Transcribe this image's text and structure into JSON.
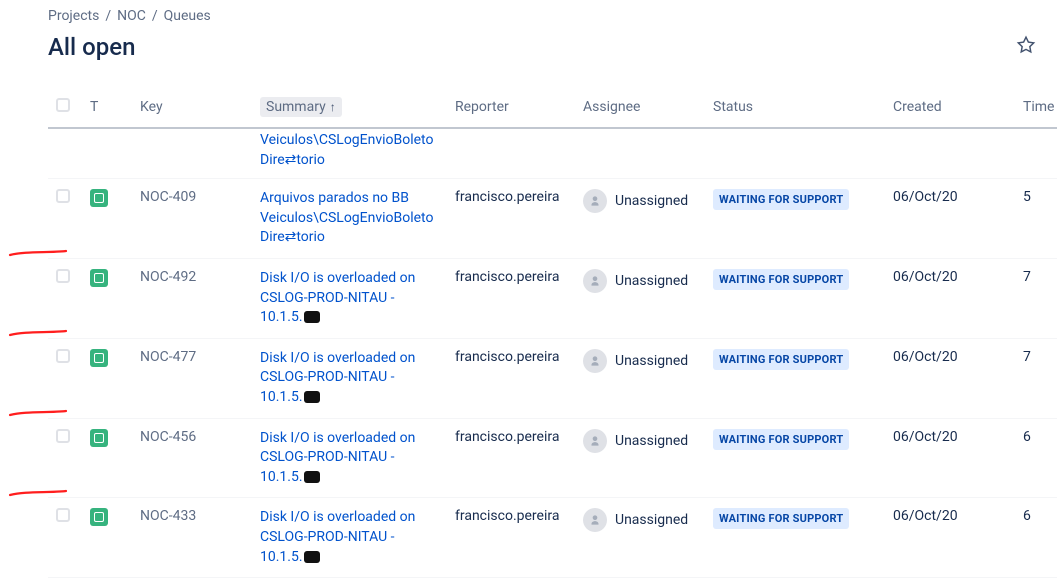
{
  "breadcrumb": {
    "a": "Projects",
    "b": "NOC",
    "c": "Queues"
  },
  "title": "All open",
  "headers": {
    "type": "T",
    "key": "Key",
    "summary": "Summary",
    "reporter": "Reporter",
    "assignee": "Assignee",
    "status": "Status",
    "created": "Created",
    "time": "Time"
  },
  "sort_indicator": "↑",
  "partial_row": {
    "summary": "Veiculos\\CSLogEnvioBoletoDire⇄torio"
  },
  "rows": [
    {
      "key": "NOC-409",
      "summary_a": "Arquivos parados no BB",
      "summary_b": "Veiculos\\CSLogEnvioBoletoDire⇄torio",
      "redacted": false,
      "reporter": "francisco.pereira",
      "assignee": "Unassigned",
      "status": "WAITING FOR SUPPORT",
      "created": "06/Oct/20",
      "time": "5",
      "mark": false
    },
    {
      "key": "NOC-492",
      "summary_a": "Disk I/O is overloaded on",
      "summary_b": "CSLOG-PROD-NITAU -",
      "summary_c": "10.1.5.",
      "redacted": true,
      "reporter": "francisco.pereira",
      "assignee": "Unassigned",
      "status": "WAITING FOR SUPPORT",
      "created": "06/Oct/20",
      "time": "7",
      "mark": true
    },
    {
      "key": "NOC-477",
      "summary_a": "Disk I/O is overloaded on",
      "summary_b": "CSLOG-PROD-NITAU -",
      "summary_c": "10.1.5.",
      "redacted": true,
      "reporter": "francisco.pereira",
      "assignee": "Unassigned",
      "status": "WAITING FOR SUPPORT",
      "created": "06/Oct/20",
      "time": "7",
      "mark": true
    },
    {
      "key": "NOC-456",
      "summary_a": "Disk I/O is overloaded on",
      "summary_b": "CSLOG-PROD-NITAU -",
      "summary_c": "10.1.5.",
      "redacted": true,
      "reporter": "francisco.pereira",
      "assignee": "Unassigned",
      "status": "WAITING FOR SUPPORT",
      "created": "06/Oct/20",
      "time": "6",
      "mark": true
    },
    {
      "key": "NOC-433",
      "summary_a": "Disk I/O is overloaded on",
      "summary_b": "CSLOG-PROD-NITAU -",
      "summary_c": "10.1.5.",
      "redacted": true,
      "reporter": "francisco.pereira",
      "assignee": "Unassigned",
      "status": "WAITING FOR SUPPORT",
      "created": "06/Oct/20",
      "time": "6",
      "mark": true
    }
  ]
}
